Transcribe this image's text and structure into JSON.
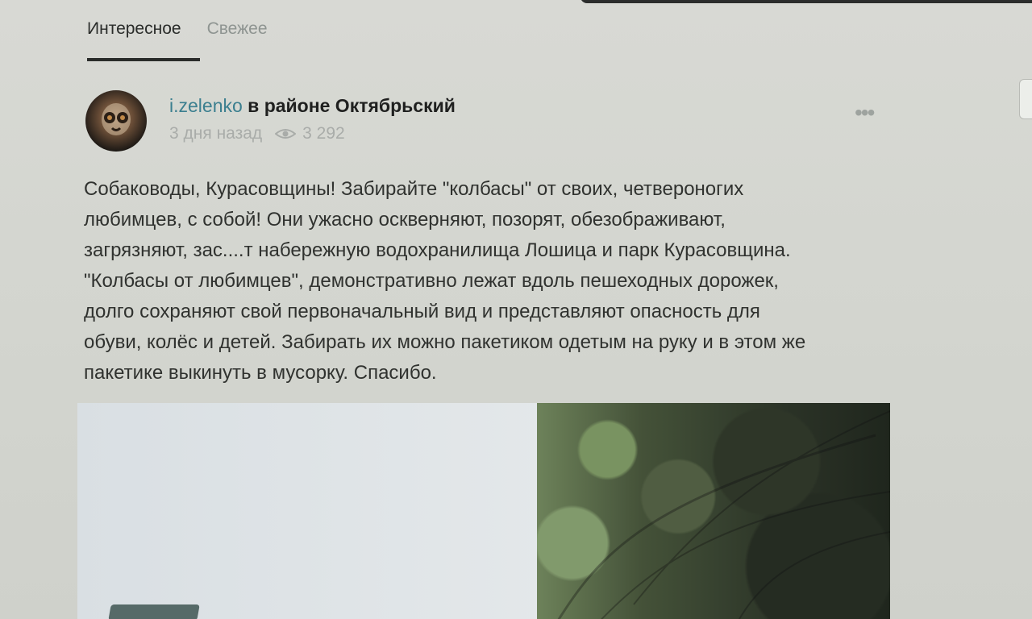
{
  "tabs": {
    "interesting": "Интересное",
    "fresh": "Свежее"
  },
  "post": {
    "username": "i.zelenko",
    "district": "в районе Октябрьский",
    "time_ago": "3 дня назад",
    "views": "3 292",
    "more_label": "•••",
    "body": "Собаководы, Курасовщины! Забирайте \"колбасы\" от своих, четвероногих\nлюбимцев, с собой! Они ужасно оскверняют, позорят, обезображивают,\nзагрязняют, зас....т набережную водохранилища Лошица и парк Курасовщина.\n\"Колбасы от любимцев\", демонстративно лежат вдоль пешеходных дорожек,\nдолго сохраняют свой первоначальный вид и представляют опасность для\nобуви, колёс и детей. Забирать их можно пакетиком одетым на руку и в этом же\nпакетике выкинуть в мусорку. Спасибо."
  },
  "icons": {
    "views": "eye-icon",
    "more": "more-options-icon"
  },
  "colors": {
    "username": "#3b7f8f",
    "text": "#30322f",
    "muted": "#a9aca9"
  }
}
